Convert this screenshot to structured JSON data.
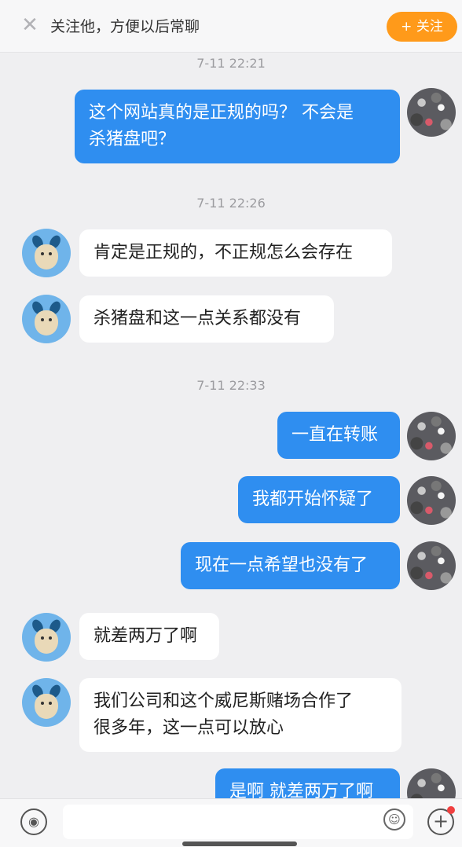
{
  "banner": {
    "close_icon": "✕",
    "text": "关注他，方便以后常聊",
    "follow_label": "+ 关注"
  },
  "chat": {
    "timestamps": [
      "7-11 22:21",
      "7-11 22:26",
      "7-11 22:33"
    ],
    "messages": [
      {
        "from": "user",
        "text": "这个网站真的是正规的吗？ 不会是\n杀猪盘吧？"
      },
      {
        "from": "other",
        "text": "肯定是正规的，不正规怎么会存在"
      },
      {
        "from": "other",
        "text": "杀猪盘和这一点关系都没有"
      },
      {
        "from": "user",
        "text": "一直在转账"
      },
      {
        "from": "user",
        "text": "我都开始怀疑了"
      },
      {
        "from": "user",
        "text": "现在一点希望也没有了"
      },
      {
        "from": "other",
        "text": "就差两万了啊"
      },
      {
        "from": "other",
        "text": "我们公司和这个威尼斯赌场合作了\n很多年，这一点可以放心"
      },
      {
        "from": "user",
        "text": "是啊 就差两万了啊"
      }
    ]
  },
  "input": {
    "voice_icon": "voice-icon",
    "emoji_icon": "emoji-icon",
    "plus_icon": "plus-icon"
  },
  "colors": {
    "outgoing_bubble": "#2f8ef0",
    "incoming_bubble": "#ffffff",
    "follow_button": "#ff9a1a",
    "background": "#efeff1"
  }
}
